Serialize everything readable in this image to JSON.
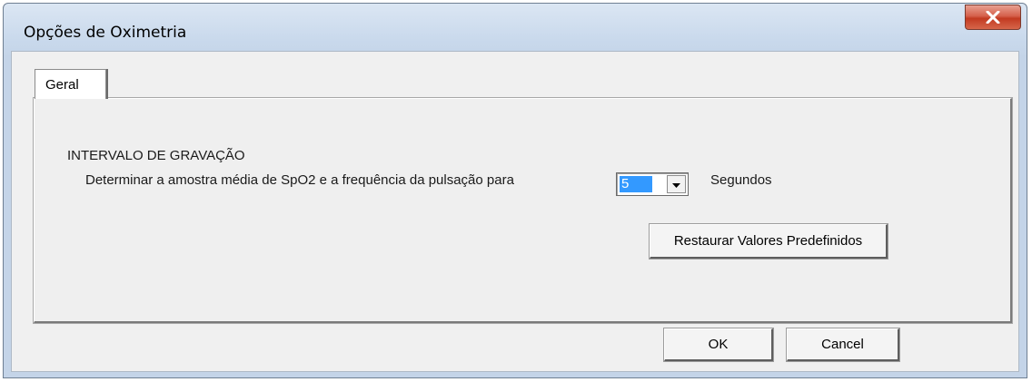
{
  "window": {
    "title": "Opções de Oximetria"
  },
  "tabs": [
    {
      "label": "Geral",
      "selected": true
    }
  ],
  "recording": {
    "heading": "INTERVALO DE GRAVAÇÃO",
    "description": "Determinar a amostra média de SpO2 e a frequência da pulsação para",
    "interval_value": "5",
    "unit": "Segundos"
  },
  "buttons": {
    "restore_label": "Restaurar Valores Predefinidos",
    "ok_label": "OK",
    "cancel_label": "Cancel"
  },
  "icons": {
    "close": "close-icon",
    "dropdown": "chevron-down-icon"
  },
  "colors": {
    "selection": "#3399ff",
    "close_button": "#c23a21",
    "title_bar": "#c9d9ec"
  }
}
